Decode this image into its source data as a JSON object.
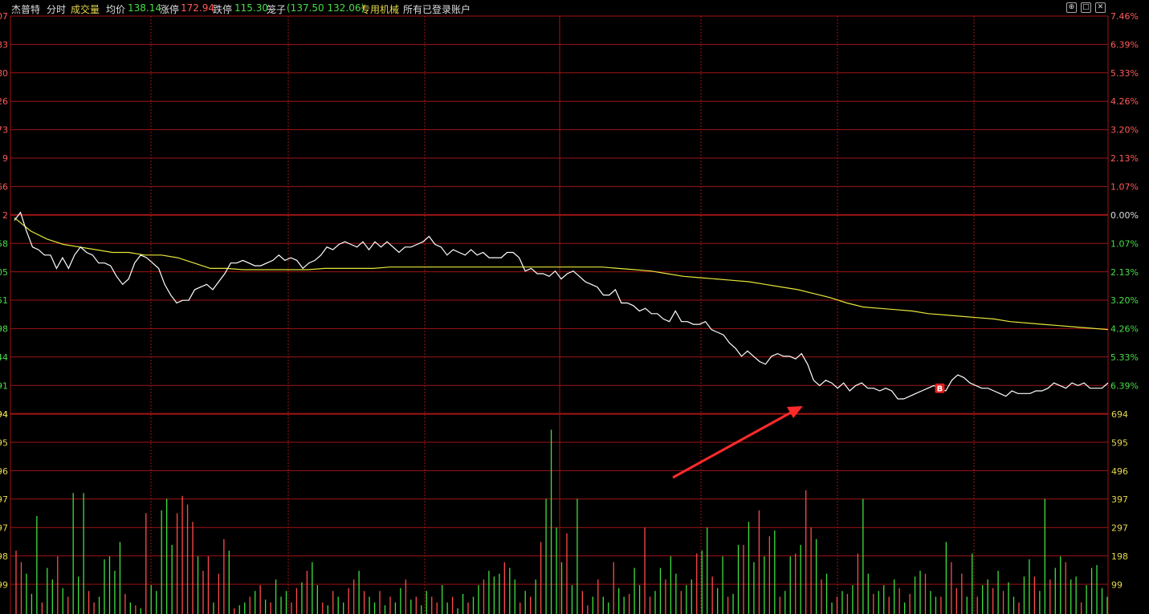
{
  "header": {
    "stock_name": "杰普特",
    "tab_timeshare": "分时",
    "tab_volume": "成交量",
    "avg_label": "均价",
    "avg_value": "138.14",
    "limit_up_label": "涨停",
    "limit_up_value": "172.94",
    "limit_down_label": "跌停",
    "limit_down_value": "115.30",
    "cage_label": "笼子",
    "cage_value": "(137.50 132.06)",
    "sector": "专用机械",
    "accounts": "所有已登录账户"
  },
  "window_controls": [
    "⊕",
    "□",
    "✕"
  ],
  "colors": {
    "background": "#000000",
    "grid": "#a01515",
    "price_line": "#ffffff",
    "avg_line": "#e6e63a",
    "up": "#ff4b4b",
    "down": "#3fe03f",
    "axis_text_red": "#ff5a5a",
    "axis_text_green": "#48dd48",
    "axis_text_yellow": "#e6d84a",
    "arrow": "#ff2a2a"
  },
  "chart_data": {
    "type": "line",
    "price": {
      "left_ticks_upper": [
        "07",
        "83",
        "80",
        "26",
        "73",
        "9",
        "66",
        "2"
      ],
      "left_ticks_lower": [
        "58",
        "05",
        "51",
        "98",
        "44",
        "91",
        "94"
      ],
      "right_ticks_upper": [
        "7.46%",
        "6.39%",
        "5.33%",
        "4.26%",
        "3.20%",
        "2.13%",
        "1.07%",
        "0.00%"
      ],
      "right_ticks_lower": [
        "1.07%",
        "2.13%",
        "3.20%",
        "4.26%",
        "5.33%",
        "6.39%"
      ],
      "pct_range": [
        -6.9,
        7.46
      ],
      "series": [
        {
          "name": "price_pct",
          "values": [
            -0.2,
            0.1,
            -0.6,
            -1.2,
            -1.3,
            -1.5,
            -1.5,
            -2.0,
            -1.6,
            -2.0,
            -1.5,
            -1.2,
            -1.4,
            -1.5,
            -1.8,
            -1.8,
            -1.9,
            -2.3,
            -2.6,
            -2.4,
            -1.8,
            -1.5,
            -1.6,
            -1.8,
            -2.0,
            -2.6,
            -3.0,
            -3.3,
            -3.2,
            -3.2,
            -2.8,
            -2.7,
            -2.6,
            -2.8,
            -2.5,
            -2.2,
            -1.8,
            -1.8,
            -1.7,
            -1.8,
            -1.9,
            -1.9,
            -1.8,
            -1.7,
            -1.5,
            -1.7,
            -1.6,
            -1.7,
            -2.0,
            -1.8,
            -1.7,
            -1.5,
            -1.2,
            -1.3,
            -1.1,
            -1.0,
            -1.1,
            -1.2,
            -1.0,
            -1.3,
            -1.0,
            -1.2,
            -1.0,
            -1.2,
            -1.4,
            -1.2,
            -1.2,
            -1.1,
            -1.0,
            -0.8,
            -1.1,
            -1.2,
            -1.5,
            -1.3,
            -1.4,
            -1.5,
            -1.3,
            -1.5,
            -1.4,
            -1.6,
            -1.6,
            -1.6,
            -1.4,
            -1.4,
            -1.6,
            -2.1,
            -2.0,
            -2.2,
            -2.2,
            -2.3,
            -2.1,
            -2.4,
            -2.2,
            -2.1,
            -2.3,
            -2.5,
            -2.6,
            -2.7,
            -3.0,
            -3.0,
            -2.8,
            -3.3,
            -3.3,
            -3.4,
            -3.6,
            -3.5,
            -3.7,
            -3.7,
            -3.9,
            -4.0,
            -3.6,
            -4.0,
            -4.0,
            -4.1,
            -4.1,
            -4.0,
            -4.3,
            -4.4,
            -4.5,
            -4.8,
            -5.0,
            -5.3,
            -5.1,
            -5.3,
            -5.5,
            -5.6,
            -5.3,
            -5.2,
            -5.3,
            -5.3,
            -5.4,
            -5.2,
            -5.6,
            -6.2,
            -6.4,
            -6.2,
            -6.3,
            -6.5,
            -6.3,
            -6.6,
            -6.4,
            -6.3,
            -6.5,
            -6.5,
            -6.6,
            -6.5,
            -6.6,
            -6.9,
            -6.9,
            -6.8,
            -6.7,
            -6.6,
            -6.5,
            -6.4,
            -6.5,
            -6.6,
            -6.2,
            -6.0,
            -6.1,
            -6.3,
            -6.4,
            -6.5,
            -6.5,
            -6.6,
            -6.7,
            -6.8,
            -6.6,
            -6.7,
            -6.7,
            -6.7,
            -6.6,
            -6.6,
            -6.5,
            -6.3,
            -6.4,
            -6.5,
            -6.3,
            -6.4,
            -6.3,
            -6.5,
            -6.5,
            -6.5,
            -6.3
          ]
        },
        {
          "name": "avg_pct",
          "values": [
            -0.1,
            -0.6,
            -0.9,
            -1.1,
            -1.2,
            -1.3,
            -1.4,
            -1.4,
            -1.5,
            -1.5,
            -1.6,
            -1.8,
            -2.0,
            -2.0,
            -2.05,
            -2.05,
            -2.05,
            -2.05,
            -2.05,
            -2.0,
            -2.0,
            -2.0,
            -2.0,
            -1.95,
            -1.95,
            -1.95,
            -1.95,
            -1.95,
            -1.95,
            -1.95,
            -1.95,
            -1.95,
            -1.95,
            -1.95,
            -1.95,
            -1.95,
            -1.95,
            -2.0,
            -2.05,
            -2.1,
            -2.2,
            -2.3,
            -2.35,
            -2.4,
            -2.45,
            -2.5,
            -2.6,
            -2.7,
            -2.8,
            -2.95,
            -3.1,
            -3.3,
            -3.45,
            -3.5,
            -3.55,
            -3.6,
            -3.7,
            -3.75,
            -3.8,
            -3.85,
            -3.9,
            -4.0,
            -4.05,
            -4.1,
            -4.15,
            -4.2,
            -4.25,
            -4.3
          ]
        }
      ]
    },
    "volume": {
      "left_ticks": [
        "694",
        "595",
        "496",
        "397",
        "297",
        "198",
        "99"
      ],
      "right_ticks": [
        "694",
        "595",
        "496",
        "397",
        "297",
        "198",
        "99"
      ],
      "max": 694,
      "values": [
        220,
        180,
        140,
        70,
        340,
        40,
        160,
        120,
        200,
        90,
        60,
        420,
        130,
        420,
        80,
        40,
        60,
        190,
        200,
        150,
        250,
        70,
        40,
        30,
        20,
        350,
        100,
        80,
        360,
        400,
        240,
        350,
        410,
        380,
        320,
        200,
        150,
        200,
        40,
        140,
        260,
        220,
        20,
        30,
        40,
        60,
        80,
        100,
        50,
        40,
        120,
        60,
        80,
        40,
        90,
        110,
        150,
        180,
        100,
        40,
        30,
        80,
        60,
        40,
        90,
        120,
        150,
        80,
        60,
        40,
        80,
        30,
        60,
        40,
        90,
        120,
        50,
        60,
        30,
        80,
        60,
        40,
        100,
        40,
        60,
        20,
        70,
        40,
        60,
        100,
        120,
        150,
        130,
        140,
        180,
        160,
        120,
        40,
        80,
        60,
        120,
        250,
        400,
        640,
        300,
        180,
        280,
        100,
        400,
        80,
        30,
        60,
        120,
        60,
        40,
        180,
        90,
        60,
        70,
        160,
        100,
        300,
        60,
        80,
        160,
        120,
        200,
        140,
        80,
        100,
        120,
        210,
        220,
        300,
        130,
        90,
        200,
        60,
        70,
        240,
        240,
        320,
        180,
        360,
        200,
        270,
        290,
        60,
        80,
        200,
        210,
        240,
        430,
        300,
        260,
        120,
        140,
        40,
        60,
        80,
        70,
        100,
        210,
        400,
        140,
        70,
        80,
        100,
        60,
        120,
        90,
        40,
        70,
        130,
        150,
        140,
        80,
        60,
        60,
        250,
        180,
        90,
        140,
        60,
        210,
        60,
        100,
        120,
        90,
        150,
        80,
        110,
        60,
        40,
        130,
        190,
        130,
        80,
        400,
        120,
        160,
        200,
        180,
        120,
        130,
        40,
        100,
        160,
        170,
        90,
        60
      ],
      "up_flags": [
        1,
        1,
        0,
        0,
        0,
        1,
        0,
        0,
        1,
        0,
        1,
        0,
        0,
        0,
        1,
        1,
        0,
        0,
        0,
        0,
        0,
        1,
        0,
        1,
        0,
        1,
        0,
        0,
        0,
        0,
        0,
        1,
        1,
        1,
        1,
        0,
        1,
        1,
        0,
        1,
        1,
        0,
        1,
        0,
        0,
        1,
        0,
        1,
        0,
        1,
        0,
        0,
        0,
        1,
        1,
        0,
        1,
        0,
        0,
        1,
        0,
        1,
        0,
        0,
        1,
        1,
        0,
        1,
        0,
        0,
        1,
        0,
        1,
        0,
        0,
        1,
        0,
        1,
        0,
        0,
        1,
        1,
        0,
        0,
        1,
        0,
        0,
        1,
        0,
        0,
        1,
        0,
        0,
        0,
        1,
        0,
        0,
        1,
        0,
        1,
        0,
        1,
        0,
        0,
        0,
        0,
        1,
        0,
        0,
        1,
        1,
        0,
        1,
        0,
        0,
        1,
        0,
        0,
        1,
        0,
        0,
        1,
        1,
        0,
        0,
        1,
        0,
        0,
        1,
        0,
        0,
        1,
        0,
        0,
        1,
        0,
        0,
        1,
        0,
        0,
        1,
        0,
        0,
        1,
        0,
        1,
        0,
        1,
        0,
        0,
        1,
        0,
        1,
        1,
        0,
        1,
        0,
        0,
        1,
        0,
        1,
        0,
        1,
        0,
        0,
        1,
        0,
        0,
        1,
        0,
        1,
        0,
        1,
        0,
        0,
        1,
        0,
        0,
        1,
        0,
        1,
        1,
        1,
        0,
        0,
        1,
        0,
        0,
        1,
        0,
        1,
        0,
        0,
        1,
        0,
        0,
        1,
        0,
        0,
        1,
        0,
        0,
        1,
        0,
        0,
        1,
        0
      ]
    },
    "trade_marker": {
      "label": "B",
      "index": 154
    }
  }
}
